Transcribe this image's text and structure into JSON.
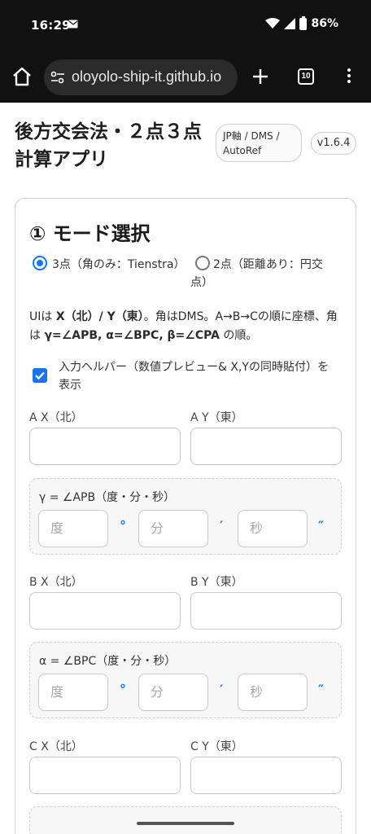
{
  "status": {
    "time": "16:29",
    "battery": "86%"
  },
  "browser": {
    "url": "oloyolo-ship-it.github.io",
    "tab_count": "10"
  },
  "header": {
    "title": "後方交会法・２点３点計算アプリ",
    "badge": "JP軸 / DMS / AutoRef",
    "version": "v1.6.4"
  },
  "mode": {
    "title": "① モード選択",
    "option1": "3点（角のみ：Tienstra）",
    "option2": "2点（距離あり：円交点）",
    "selected": "option1",
    "description_plain_1": "UIは ",
    "description_bold_1": "X（北）/ Y（東）",
    "description_plain_2": "。角はDMS。A→B→Cの順に座標、角は ",
    "description_bold_2": "γ=∠APB, α=∠BPC, β=∠CPA",
    "description_plain_3": " の順。",
    "helper_label": "入力ヘルパー（数値プレビュー& X,Yの同時貼付）を表示",
    "helper_checked": true
  },
  "fields": {
    "ax": "A X（北）",
    "ay": "A Y（東）",
    "bx": "B X（北）",
    "by": "B Y（東）",
    "cx": "C X（北）",
    "cy": "C Y（東）"
  },
  "angles": {
    "gamma": "γ = ∠APB（度・分・秒）",
    "alpha": "α = ∠BPC（度・分・秒）",
    "deg_placeholder": "度",
    "min_placeholder": "分",
    "sec_placeholder": "秒",
    "deg_unit": "°",
    "min_unit": "′",
    "sec_unit": "″"
  }
}
